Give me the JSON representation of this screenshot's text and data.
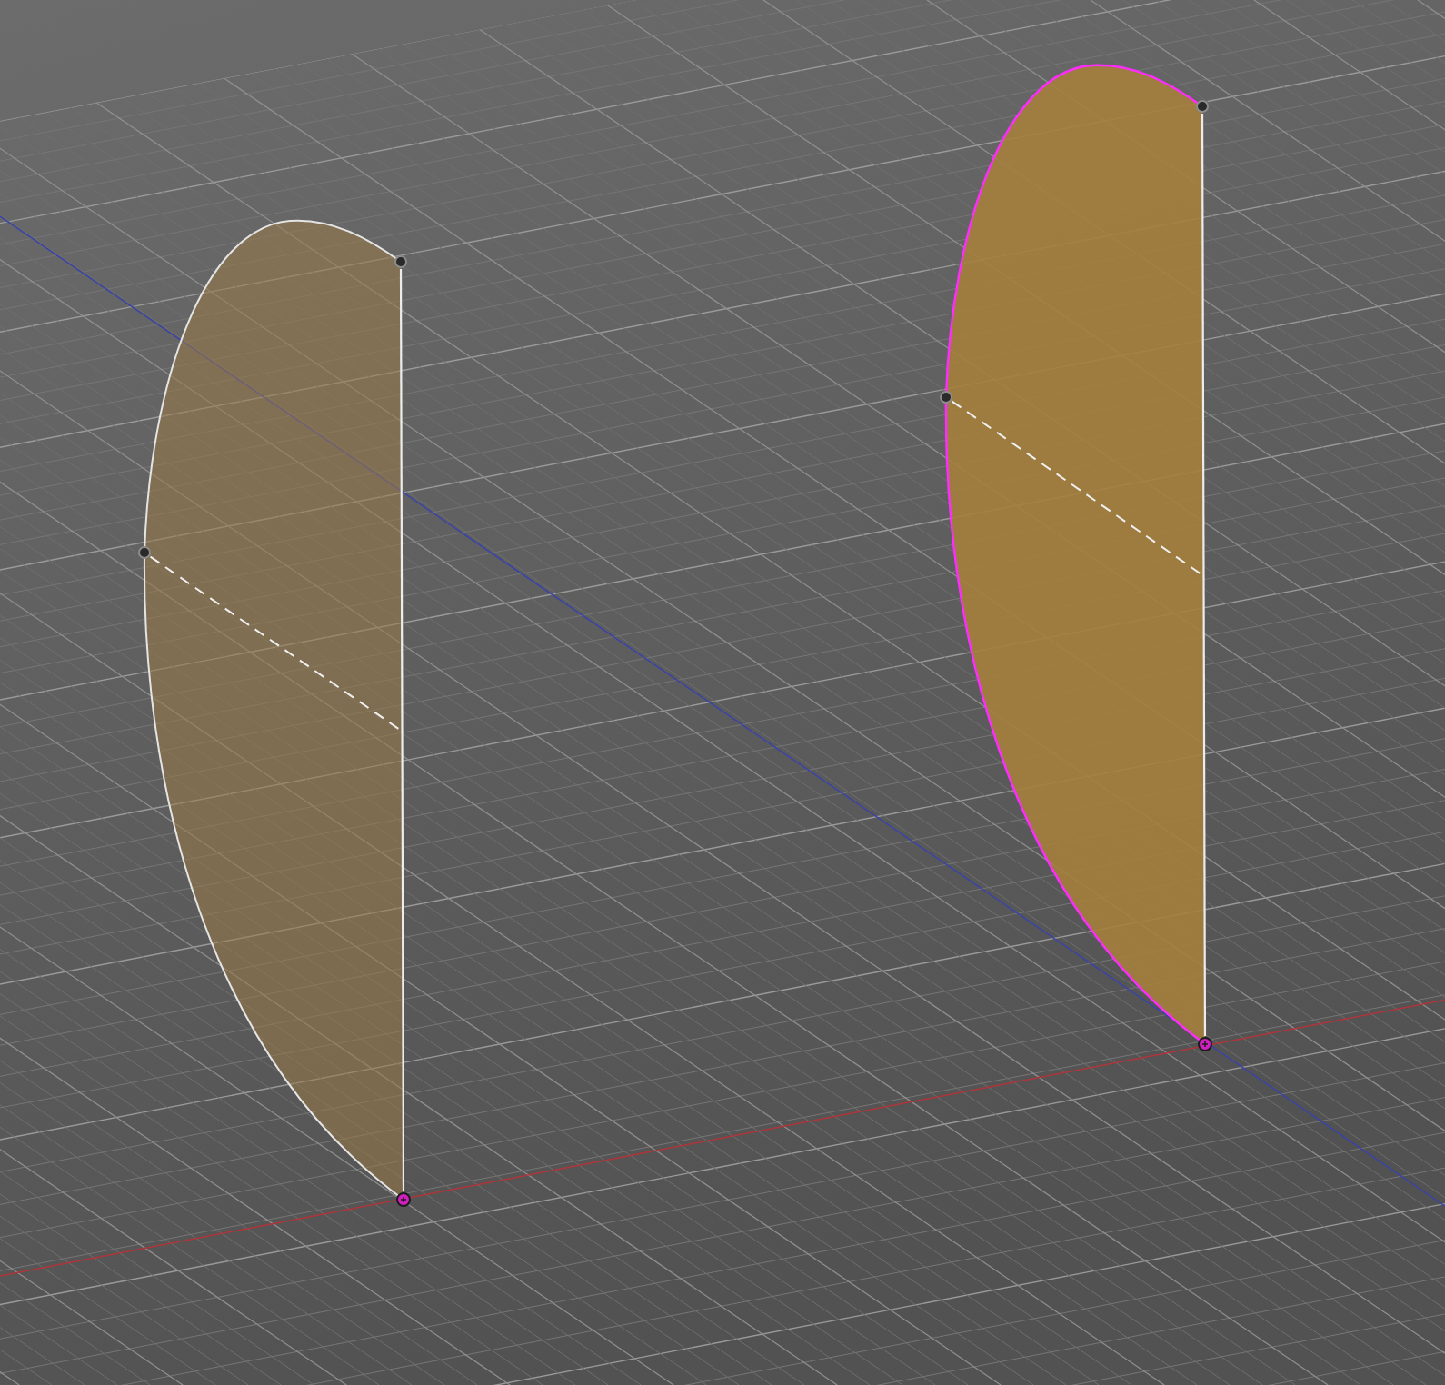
{
  "viewport": {
    "profiles": [
      {
        "selected": false,
        "points": [
          {
            "kind": "sketch-point"
          },
          {
            "kind": "sketch-point"
          },
          {
            "kind": "origin"
          }
        ]
      },
      {
        "selected": true,
        "points": [
          {
            "kind": "sketch-point"
          },
          {
            "kind": "sketch-point"
          },
          {
            "kind": "origin"
          }
        ]
      }
    ]
  }
}
